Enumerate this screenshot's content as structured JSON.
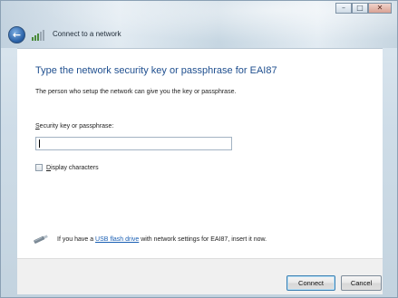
{
  "window": {
    "caption": {
      "minimize": "–",
      "maximize": "□",
      "close": "✕"
    }
  },
  "nav": {
    "back_icon": "back-arrow-icon",
    "title": "Connect to a network"
  },
  "main": {
    "heading": "Type the network security key or passphrase for EAI87",
    "subtext": "The person who setup the network can give you the key or passphrase.",
    "field_label_accesskey": "S",
    "field_label_rest": "ecurity key or passphrase:",
    "key_value": "",
    "checkbox": {
      "accesskey": "D",
      "label_rest": "isplay characters",
      "checked": false
    },
    "usb": {
      "prefix": "If you have a ",
      "link": "USB flash drive",
      "suffix": " with network settings for EAI87, insert it now."
    }
  },
  "footer": {
    "connect_label": "Connect",
    "cancel_label": "Cancel"
  },
  "colors": {
    "heading": "#1f4f8f",
    "link": "#1a5fb4",
    "close_button": "#d9a193"
  }
}
